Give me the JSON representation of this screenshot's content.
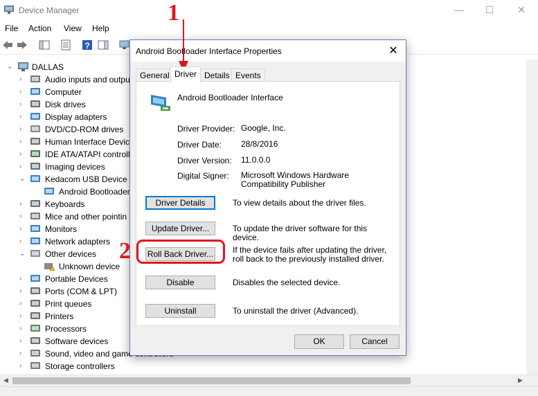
{
  "window": {
    "title": "Device Manager"
  },
  "menu": [
    "File",
    "Action",
    "View",
    "Help"
  ],
  "tree": {
    "root": "DALLAS",
    "items": [
      {
        "label": "Audio inputs and outpu",
        "level": 1,
        "expanded": false,
        "icon": "speaker-icon"
      },
      {
        "label": "Computer",
        "level": 1,
        "expanded": false,
        "icon": "computer-icon"
      },
      {
        "label": "Disk drives",
        "level": 1,
        "expanded": false,
        "icon": "disk-icon"
      },
      {
        "label": "Display adapters",
        "level": 1,
        "expanded": false,
        "icon": "display-icon"
      },
      {
        "label": "DVD/CD-ROM drives",
        "level": 1,
        "expanded": false,
        "icon": "dvd-icon"
      },
      {
        "label": "Human Interface Devic",
        "level": 1,
        "expanded": false,
        "icon": "hid-icon"
      },
      {
        "label": "IDE ATA/ATAPI controll",
        "level": 1,
        "expanded": false,
        "icon": "ide-icon"
      },
      {
        "label": "Imaging devices",
        "level": 1,
        "expanded": false,
        "icon": "camera-icon"
      },
      {
        "label": "Kedacom USB Device",
        "level": 1,
        "expanded": true,
        "icon": "usb-device-icon"
      },
      {
        "label": "Android Bootloader",
        "level": 2,
        "expanded": null,
        "icon": "usb-device-icon"
      },
      {
        "label": "Keyboards",
        "level": 1,
        "expanded": false,
        "icon": "keyboard-icon"
      },
      {
        "label": "Mice and other pointin",
        "level": 1,
        "expanded": false,
        "icon": "mouse-icon"
      },
      {
        "label": "Monitors",
        "level": 1,
        "expanded": false,
        "icon": "monitor-icon"
      },
      {
        "label": "Network adapters",
        "level": 1,
        "expanded": false,
        "icon": "network-icon"
      },
      {
        "label": "Other devices",
        "level": 1,
        "expanded": true,
        "icon": "other-devices-icon"
      },
      {
        "label": "Unknown device",
        "level": 2,
        "expanded": null,
        "icon": "warning-device-icon"
      },
      {
        "label": "Portable Devices",
        "level": 1,
        "expanded": false,
        "icon": "portable-icon"
      },
      {
        "label": "Ports (COM & LPT)",
        "level": 1,
        "expanded": false,
        "icon": "port-icon"
      },
      {
        "label": "Print queues",
        "level": 1,
        "expanded": false,
        "icon": "printer-icon"
      },
      {
        "label": "Printers",
        "level": 1,
        "expanded": false,
        "icon": "printer-icon"
      },
      {
        "label": "Processors",
        "level": 1,
        "expanded": false,
        "icon": "cpu-icon"
      },
      {
        "label": "Software devices",
        "level": 1,
        "expanded": false,
        "icon": "software-icon"
      },
      {
        "label": "Sound, video and game controllers",
        "level": 1,
        "expanded": false,
        "icon": "speaker-icon"
      },
      {
        "label": "Storage controllers",
        "level": 1,
        "expanded": false,
        "icon": "storage-icon"
      }
    ]
  },
  "dialog": {
    "title": "Android Bootloader Interface Properties",
    "tabs": [
      "General",
      "Driver",
      "Details",
      "Events"
    ],
    "active_tab": "Driver",
    "device_name": "Android Bootloader Interface",
    "properties": {
      "provider_label": "Driver Provider:",
      "provider": "Google, Inc.",
      "date_label": "Driver Date:",
      "date": "28/8/2016",
      "version_label": "Driver Version:",
      "version": "11.0.0.0",
      "signer_label": "Digital Signer:",
      "signer": "Microsoft Windows Hardware Compatibility Publisher"
    },
    "actions": {
      "details_label": "Driver Details",
      "details_desc": "To view details about the driver files.",
      "update_label": "Update Driver...",
      "update_desc": "To update the driver software for this device.",
      "rollback_label": "Roll Back Driver...",
      "rollback_desc": "If the device fails after updating the driver, roll back to the previously installed driver.",
      "disable_label": "Disable",
      "disable_desc": "Disables the selected device.",
      "uninstall_label": "Uninstall",
      "uninstall_desc": "To uninstall the driver (Advanced)."
    },
    "ok_label": "OK",
    "cancel_label": "Cancel"
  },
  "annotations": {
    "step1": "1",
    "step2": "2",
    "color": "#d61920"
  }
}
